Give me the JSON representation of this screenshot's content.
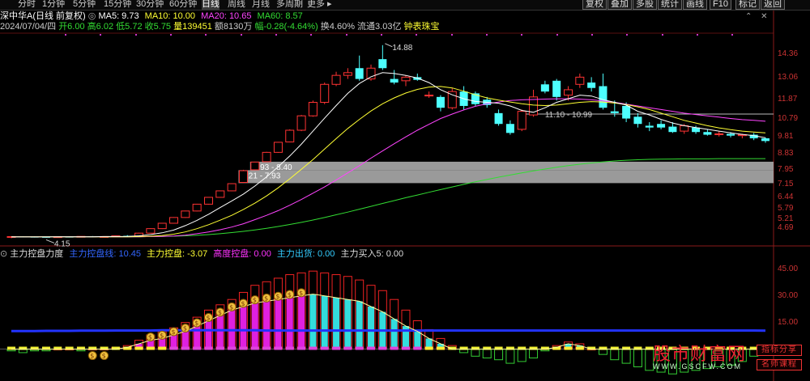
{
  "period_tabs": [
    {
      "label": "分时",
      "selected": false
    },
    {
      "label": "1分钟",
      "selected": false
    },
    {
      "label": "5分钟",
      "selected": false
    },
    {
      "label": "15分钟",
      "selected": false
    },
    {
      "label": "30分钟",
      "selected": false
    },
    {
      "label": "60分钟",
      "selected": false
    },
    {
      "label": "日线",
      "selected": true
    },
    {
      "label": "周线",
      "selected": false
    },
    {
      "label": "月线",
      "selected": false
    },
    {
      "label": "多周期",
      "selected": false
    },
    {
      "label": "更多 ▸",
      "selected": false
    }
  ],
  "toolbar_buttons": [
    "复权",
    "叠加",
    "多股",
    "统计",
    "画线",
    "F10",
    "标记",
    "返回"
  ],
  "title": {
    "stock": "深中华A(日线 前复权)",
    "ma5": "MA5: 9.73",
    "ma10": "MA10: 10.00",
    "ma20": "MA20: 10.65",
    "ma60": "MA60: 8.57",
    "colors": {
      "ma5": "#ffffff",
      "ma10": "#ffff33",
      "ma20": "#ff44ff",
      "ma60": "#33dd33"
    }
  },
  "info": {
    "date": "2024/07/04/四",
    "open": "开6.00",
    "high": "高6.02",
    "low": "低5.72",
    "close": "收5.75",
    "vol": "量139451",
    "amount": "额8130万",
    "change": "幅-0.28(-4.64%)",
    "turnover": "换4.60%",
    "float_value": "流通3.03亿",
    "sector": "钟表珠宝"
  },
  "indicator": {
    "name": "主力控盘力度",
    "line": "主力控盘线: 10.45",
    "control": "主力控盘: -3.07",
    "high_control": "高度控盘: 0.00",
    "ship": "主力出货: 0.00",
    "buy": "主力买入5: 0.00"
  },
  "price_axis": [
    "14.36",
    "13.06",
    "11.87",
    "10.79",
    "9.81",
    "8.83",
    "7.95",
    "7.15",
    "6.44",
    "5.79",
    "5.21",
    "4.69"
  ],
  "ind_axis": [
    "45.00",
    "30.00",
    "15.00",
    "0.00"
  ],
  "chart_data": {
    "type": "candlestick",
    "ylim": [
      3.9,
      15.5
    ],
    "candles": [
      [
        4.2,
        4.26,
        4.15,
        4.24
      ],
      [
        4.24,
        4.26,
        4.2,
        4.23
      ],
      [
        4.23,
        4.25,
        4.19,
        4.22
      ],
      [
        4.22,
        4.24,
        4.18,
        4.21
      ],
      [
        4.21,
        4.24,
        4.17,
        4.23
      ],
      [
        4.23,
        4.25,
        4.19,
        4.22
      ],
      [
        4.22,
        4.26,
        4.2,
        4.25
      ],
      [
        4.25,
        4.27,
        4.21,
        4.23
      ],
      [
        4.23,
        4.26,
        4.2,
        4.24
      ],
      [
        4.24,
        4.3,
        4.22,
        4.28
      ],
      [
        4.28,
        4.32,
        4.24,
        4.26
      ],
      [
        4.26,
        4.45,
        4.25,
        4.43
      ],
      [
        4.43,
        4.7,
        4.42,
        4.68
      ],
      [
        4.68,
        5.0,
        4.66,
        4.98
      ],
      [
        4.98,
        5.32,
        4.96,
        5.3
      ],
      [
        5.3,
        5.68,
        5.28,
        5.66
      ],
      [
        5.66,
        6.06,
        5.64,
        6.04
      ],
      [
        6.04,
        6.44,
        6.02,
        6.42
      ],
      [
        6.42,
        6.8,
        6.4,
        6.78
      ],
      [
        6.78,
        7.2,
        6.76,
        7.18
      ],
      [
        7.25,
        7.95,
        7.21,
        7.9
      ],
      [
        7.95,
        8.4,
        7.93,
        8.38
      ],
      [
        8.4,
        8.95,
        8.39,
        8.92
      ],
      [
        8.92,
        9.5,
        8.9,
        9.48
      ],
      [
        9.5,
        10.2,
        9.48,
        10.15
      ],
      [
        10.15,
        11.0,
        10.1,
        10.95
      ],
      [
        10.95,
        11.8,
        10.9,
        11.7
      ],
      [
        11.7,
        12.8,
        11.6,
        12.7
      ],
      [
        12.7,
        13.4,
        12.6,
        13.2
      ],
      [
        13.2,
        13.6,
        13.0,
        13.35
      ],
      [
        13.6,
        14.3,
        12.9,
        13.0
      ],
      [
        13.0,
        13.8,
        12.9,
        13.6
      ],
      [
        14.1,
        14.88,
        13.5,
        13.6
      ],
      [
        13.0,
        13.5,
        12.7,
        12.8
      ],
      [
        12.9,
        13.2,
        12.6,
        13.1
      ],
      [
        13.1,
        13.3,
        12.9,
        12.95
      ],
      [
        12.1,
        12.3,
        11.95,
        12.1
      ],
      [
        12.0,
        12.1,
        11.2,
        11.4
      ],
      [
        11.4,
        12.5,
        11.3,
        12.3
      ],
      [
        12.3,
        12.6,
        11.3,
        11.5
      ],
      [
        12.2,
        12.3,
        11.5,
        11.6
      ],
      [
        11.85,
        12.0,
        11.4,
        11.55
      ],
      [
        11.1,
        11.3,
        10.4,
        10.5
      ],
      [
        10.5,
        10.7,
        9.9,
        10.0
      ],
      [
        10.2,
        11.3,
        10.1,
        11.2
      ],
      [
        11.0,
        12.4,
        10.9,
        12.0
      ],
      [
        12.7,
        12.9,
        12.2,
        12.3
      ],
      [
        12.9,
        13.0,
        11.8,
        12.0
      ],
      [
        12.1,
        12.6,
        11.8,
        12.4
      ],
      [
        12.7,
        13.3,
        12.5,
        13.1
      ],
      [
        12.8,
        13.1,
        12.3,
        12.5
      ],
      [
        12.6,
        13.3,
        11.3,
        11.4
      ],
      [
        11.2,
        11.8,
        10.9,
        11.1
      ],
      [
        11.5,
        11.7,
        10.6,
        10.8
      ],
      [
        10.9,
        11.1,
        10.3,
        10.5
      ],
      [
        10.4,
        10.6,
        10.1,
        10.3
      ],
      [
        10.5,
        10.7,
        10.2,
        10.3
      ],
      [
        10.35,
        10.6,
        10.0,
        10.05
      ],
      [
        10.1,
        10.5,
        9.95,
        10.4
      ],
      [
        10.3,
        10.4,
        9.95,
        10.05
      ],
      [
        10.05,
        10.2,
        9.85,
        9.9
      ],
      [
        9.92,
        10.1,
        9.8,
        9.95
      ],
      [
        9.95,
        10.05,
        9.75,
        9.85
      ],
      [
        9.85,
        9.95,
        9.7,
        9.9
      ],
      [
        9.9,
        10.0,
        9.6,
        9.7
      ],
      [
        9.7,
        9.75,
        9.45,
        9.55
      ]
    ],
    "ma5": [
      4.22,
      4.22,
      4.22,
      4.22,
      4.23,
      4.23,
      4.23,
      4.23,
      4.24,
      4.24,
      4.25,
      4.28,
      4.35,
      4.45,
      4.6,
      4.85,
      5.14,
      5.48,
      5.85,
      6.22,
      6.6,
      7.05,
      7.56,
      8.12,
      8.72,
      9.38,
      10.1,
      10.82,
      11.52,
      12.2,
      12.75,
      13.12,
      13.35,
      13.3,
      13.2,
      13.05,
      12.8,
      12.4,
      12.12,
      11.9,
      11.75,
      11.7,
      11.65,
      11.5,
      11.25,
      11.15,
      11.4,
      11.7,
      11.9,
      12.1,
      12.05,
      11.85,
      11.7,
      11.55,
      11.2,
      11.0,
      10.75,
      10.55,
      10.4,
      10.3,
      10.2,
      10.1,
      10.0,
      9.92,
      9.85,
      9.73
    ],
    "ma10": [
      4.23,
      4.23,
      4.23,
      4.23,
      4.23,
      4.23,
      4.23,
      4.23,
      4.23,
      4.23,
      4.23,
      4.24,
      4.26,
      4.3,
      4.37,
      4.5,
      4.68,
      4.9,
      5.15,
      5.42,
      5.75,
      6.1,
      6.5,
      6.95,
      7.45,
      7.98,
      8.52,
      9.1,
      9.68,
      10.25,
      10.75,
      11.22,
      11.62,
      11.95,
      12.22,
      12.42,
      12.55,
      12.58,
      12.5,
      12.32,
      12.12,
      11.95,
      11.82,
      11.72,
      11.62,
      11.55,
      11.52,
      11.55,
      11.62,
      11.7,
      11.74,
      11.72,
      11.66,
      11.58,
      11.45,
      11.3,
      11.1,
      10.9,
      10.7,
      10.55,
      10.4,
      10.28,
      10.18,
      10.1,
      10.05,
      10.0
    ],
    "ma20": [
      4.23,
      4.23,
      4.23,
      4.23,
      4.23,
      4.23,
      4.23,
      4.23,
      4.23,
      4.23,
      4.23,
      4.23,
      4.24,
      4.25,
      4.27,
      4.32,
      4.4,
      4.5,
      4.62,
      4.77,
      4.95,
      5.18,
      5.42,
      5.68,
      5.98,
      6.3,
      6.65,
      7.0,
      7.38,
      7.78,
      8.18,
      8.6,
      9.0,
      9.4,
      9.78,
      10.15,
      10.48,
      10.8,
      11.05,
      11.28,
      11.48,
      11.62,
      11.72,
      11.8,
      11.84,
      11.86,
      11.88,
      11.9,
      11.9,
      11.88,
      11.84,
      11.78,
      11.7,
      11.6,
      11.5,
      11.4,
      11.3,
      11.2,
      11.1,
      11.02,
      10.95,
      10.88,
      10.8,
      10.74,
      10.7,
      10.65
    ],
    "ma60": [
      4.23,
      4.23,
      4.23,
      4.23,
      4.23,
      4.23,
      4.23,
      4.23,
      4.23,
      4.23,
      4.23,
      4.23,
      4.24,
      4.25,
      4.26,
      4.28,
      4.31,
      4.35,
      4.4,
      4.46,
      4.53,
      4.61,
      4.7,
      4.8,
      4.91,
      5.03,
      5.16,
      5.3,
      5.45,
      5.6,
      5.76,
      5.92,
      6.08,
      6.24,
      6.4,
      6.55,
      6.7,
      6.85,
      7.0,
      7.14,
      7.28,
      7.41,
      7.54,
      7.66,
      7.78,
      7.89,
      7.99,
      8.09,
      8.18,
      8.26,
      8.33,
      8.39,
      8.44,
      8.48,
      8.51,
      8.53,
      8.54,
      8.55,
      8.56,
      8.56,
      8.56,
      8.57,
      8.57,
      8.57,
      8.57,
      8.57
    ],
    "bands": [
      {
        "label": "7.93 - 8.40",
        "low": 7.93,
        "high": 8.4,
        "start": 21
      },
      {
        "label": "7.21 - 7.93",
        "low": 7.21,
        "high": 7.93,
        "start": 20
      }
    ],
    "band_label_upper": "11.10 - 10.99",
    "annotations": {
      "high": "14.88",
      "low": "4.15"
    },
    "ind_values": [
      -2,
      -3,
      -2,
      -2,
      -1,
      -1,
      -2,
      -1,
      -1,
      0,
      1,
      3,
      5,
      6,
      8,
      10,
      13,
      16,
      19,
      22,
      24,
      26,
      27,
      28,
      29,
      30,
      31,
      30,
      29,
      28,
      27,
      24,
      21,
      17,
      13,
      10,
      6,
      3,
      0,
      -3,
      -5,
      -6,
      -8,
      -10,
      -9,
      -7,
      -3,
      1,
      3,
      2,
      -1,
      -4,
      -7,
      -10,
      -12,
      -14,
      -15,
      -16,
      -15,
      -14,
      -13,
      -12,
      -10,
      -8,
      -5,
      -3
    ],
    "ind_max": [
      -1,
      -2,
      -1,
      -1,
      0,
      0,
      -1,
      0,
      0,
      1,
      2,
      5,
      8,
      10,
      12,
      15,
      18,
      22,
      25,
      28,
      32,
      36,
      38,
      40,
      42,
      43,
      44,
      43,
      42,
      41,
      39,
      36,
      33,
      28,
      22,
      16,
      11,
      6,
      2,
      -2,
      -4,
      -5,
      -6,
      -8,
      -7,
      -5,
      -1,
      2,
      4,
      3,
      0,
      -3,
      -6,
      -8,
      -10,
      -12,
      -13,
      -14,
      -13,
      -12,
      -11,
      -10,
      -9,
      -7,
      -4,
      -2
    ],
    "ind_line": [
      10.2,
      10.2,
      10.2,
      10.3,
      10.3,
      10.3,
      10.4,
      10.4,
      10.4,
      10.5,
      10.5,
      10.5,
      10.5,
      10.6,
      10.6,
      10.6,
      10.6,
      10.6,
      10.6,
      10.6,
      10.6,
      10.6,
      10.5,
      10.5,
      10.5,
      10.5,
      10.5,
      10.5,
      10.5,
      10.5,
      10.5,
      10.5,
      10.5,
      10.5,
      10.5,
      10.5,
      10.5,
      10.5,
      10.5,
      10.5,
      10.5,
      10.5,
      10.5,
      10.5,
      10.5,
      10.5,
      10.5,
      10.5,
      10.5,
      10.5,
      10.5,
      10.5,
      10.5,
      10.5,
      10.5,
      10.5,
      10.5,
      10.5,
      10.5,
      10.5,
      10.5,
      10.5,
      10.5,
      10.5,
      10.5,
      10.45
    ],
    "ind_ylim": [
      -18,
      50
    ],
    "money_bags": [
      7,
      8,
      12,
      13,
      14,
      15,
      16,
      17,
      18,
      19,
      20,
      21,
      22,
      23,
      24,
      25
    ]
  },
  "watermark": {
    "main": "股市财富网",
    "sub": "WWW.GSCFW.COM",
    "badge1": "指标分享",
    "badge2": "名师课程"
  }
}
